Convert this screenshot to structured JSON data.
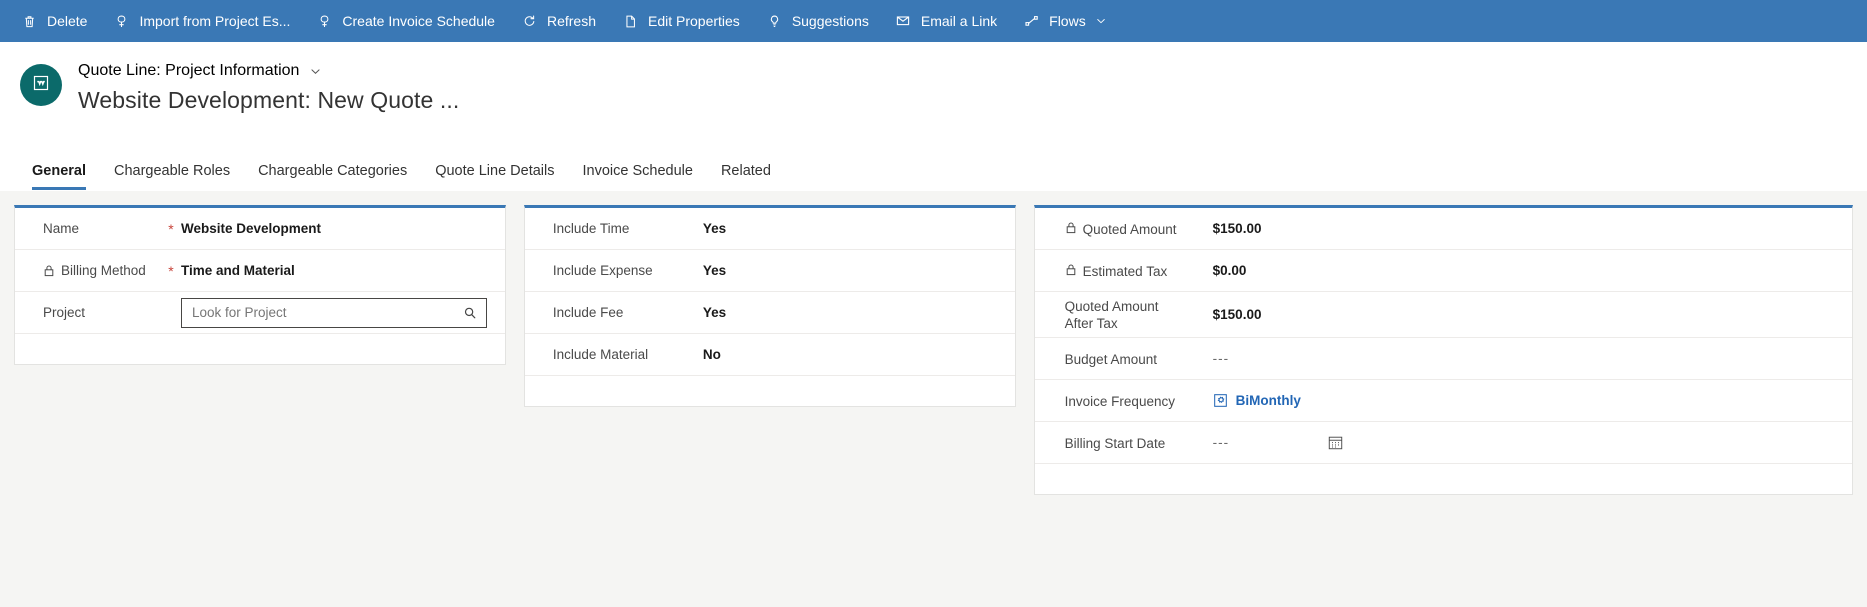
{
  "command_bar": {
    "background": "#3a78b5",
    "items": [
      {
        "label": "Delete",
        "icon": "trash-icon"
      },
      {
        "label": "Import from Project Es...",
        "icon": "import-icon"
      },
      {
        "label": "Create Invoice Schedule",
        "icon": "invoice-schedule-icon"
      },
      {
        "label": "Refresh",
        "icon": "refresh-icon"
      },
      {
        "label": "Edit Properties",
        "icon": "edit-properties-icon"
      },
      {
        "label": "Suggestions",
        "icon": "lightbulb-icon"
      },
      {
        "label": "Email a Link",
        "icon": "email-link-icon"
      },
      {
        "label": "Flows",
        "icon": "flows-icon",
        "has_chevron": true
      }
    ]
  },
  "header": {
    "breadcrumb": "Quote Line: Project Information",
    "title": "Website Development: New Quote ...",
    "avatar_icon": "quote-line-entity-icon",
    "avatar_color": "#0b6a6a"
  },
  "tabs": {
    "active": "General",
    "accent": "#3a78b5",
    "items": [
      {
        "label": "General"
      },
      {
        "label": "Chargeable Roles"
      },
      {
        "label": "Chargeable Categories"
      },
      {
        "label": "Quote Line Details"
      },
      {
        "label": "Invoice Schedule"
      },
      {
        "label": "Related"
      }
    ]
  },
  "cards": {
    "general": {
      "name": {
        "label": "Name",
        "required": "*",
        "value": "Website Development"
      },
      "billing_method": {
        "label": "Billing Method",
        "required": "*",
        "value": "Time and Material",
        "locked": true
      },
      "project": {
        "label": "Project",
        "value": "",
        "placeholder": "Look for Project",
        "search_icon": "search-icon"
      }
    },
    "includes": {
      "include_time": {
        "label": "Include Time",
        "value": "Yes"
      },
      "include_expense": {
        "label": "Include Expense",
        "value": "Yes"
      },
      "include_fee": {
        "label": "Include Fee",
        "value": "Yes"
      },
      "include_material": {
        "label": "Include Material",
        "value": "No"
      }
    },
    "amounts": {
      "quoted_amount": {
        "label": "Quoted Amount",
        "value": "$150.00",
        "locked": true
      },
      "estimated_tax": {
        "label": "Estimated Tax",
        "value": "$0.00",
        "locked": true
      },
      "quoted_amount_after_tax": {
        "label_line1": "Quoted Amount",
        "label_line2": "After Tax",
        "value": "$150.00"
      },
      "budget_amount": {
        "label": "Budget Amount",
        "value": "---"
      },
      "invoice_frequency": {
        "label": "Invoice Frequency",
        "value": "BiMonthly",
        "link_color": "#2266b5",
        "entity_icon": "invoice-frequency-entity-icon"
      },
      "billing_start_date": {
        "label": "Billing Start Date",
        "value": "---",
        "calendar_icon": "calendar-icon"
      }
    }
  }
}
